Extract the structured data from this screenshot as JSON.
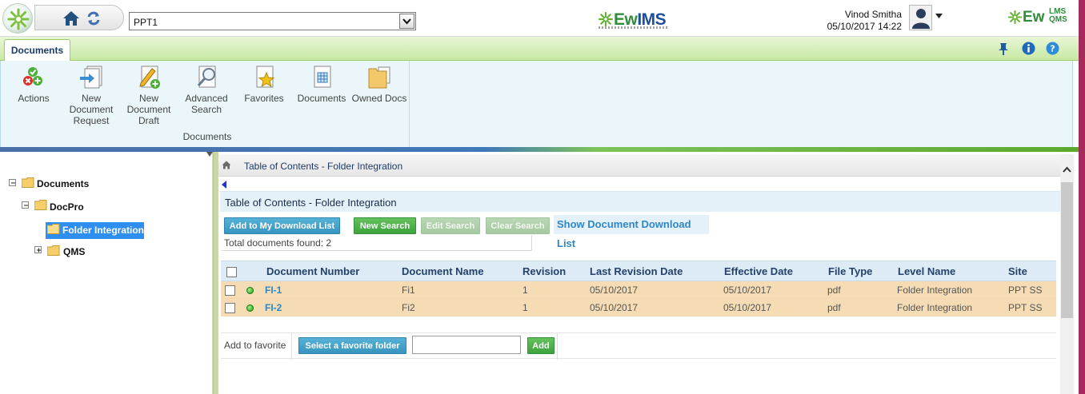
{
  "header": {
    "site_selector_value": "PPT1",
    "brand_ewims": {
      "prefix": "Ew",
      "suffix": "IMS"
    },
    "brand_ewqms": {
      "prefix": "Ew",
      "sup": "LMS",
      "sub": "QMS"
    },
    "user_name": "Vinod Smitha",
    "user_datetime": "05/10/2017 14:22"
  },
  "ribbon": {
    "tab_label": "Documents",
    "group_label": "Documents",
    "buttons": [
      {
        "label": "Actions"
      },
      {
        "label": "New Document Request"
      },
      {
        "label": "New Document Draft"
      },
      {
        "label": "Advanced Search"
      },
      {
        "label": "Favorites"
      },
      {
        "label": "Documents"
      },
      {
        "label": "Owned Docs"
      }
    ]
  },
  "tree": {
    "root": "Documents",
    "child": "DocPro",
    "selected": "Folder Integration",
    "sibling": "QMS"
  },
  "content": {
    "breadcrumb": "Table of Contents - Folder Integration",
    "section_title": "Table of Contents - Folder Integration",
    "buttons": {
      "add_download": "Add to My Download List",
      "new_search": "New Search",
      "edit_search": "Edit Search",
      "clear_search": "Clear Search"
    },
    "show_download_list": "Show Document Download List",
    "total_docs": "Total documents found: 2",
    "columns": [
      "Document Number",
      "Document Name",
      "Revision",
      "Last Revision Date",
      "Effective Date",
      "File Type",
      "Level Name",
      "Site"
    ],
    "rows": [
      {
        "number": "FI-1",
        "name": "Fi1",
        "revision": "1",
        "last_revision_date": "05/10/2017",
        "effective_date": "05/10/2017",
        "file_type": "pdf",
        "level_name": "Folder Integration",
        "site": "PPT SS"
      },
      {
        "number": "FI-2",
        "name": "Fi2",
        "revision": "1",
        "last_revision_date": "05/10/2017",
        "effective_date": "05/10/2017",
        "file_type": "pdf",
        "level_name": "Folder Integration",
        "site": "PPT SS"
      }
    ],
    "favorite": {
      "label": "Add to favorite",
      "select_button": "Select a favorite folder",
      "input_value": "",
      "add_button": "Add"
    }
  }
}
